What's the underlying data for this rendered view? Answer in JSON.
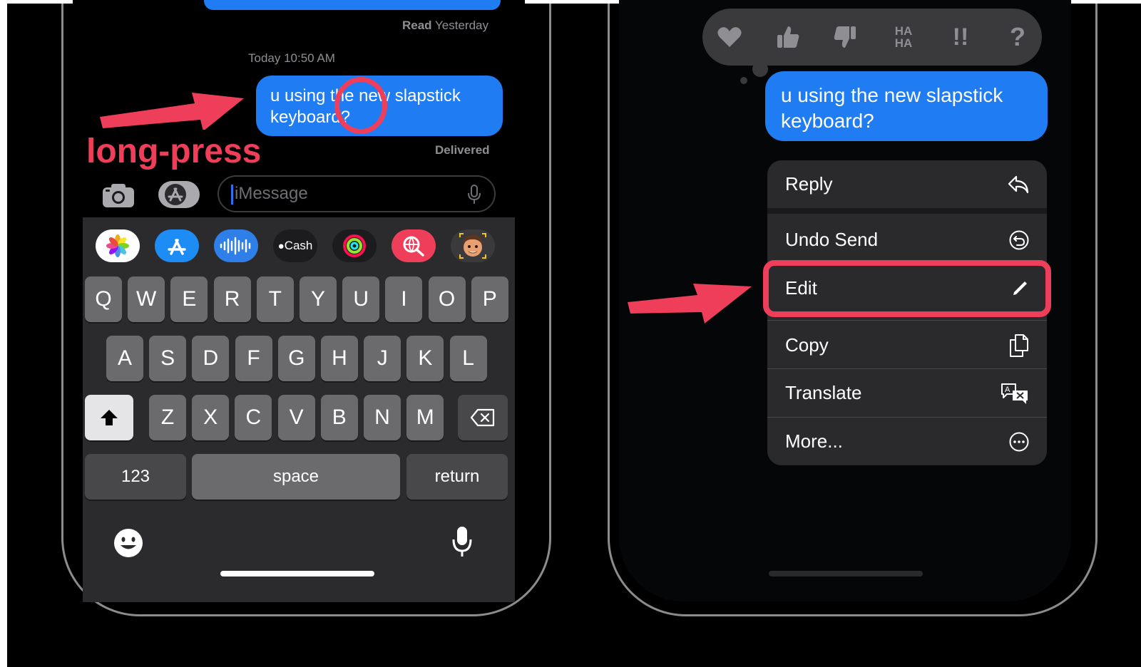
{
  "left_phone": {
    "read_status_bold": "Read",
    "read_status_rest": " Yesterday",
    "timestamp": "Today 10:50 AM",
    "message_line1": "u using the new slapstick",
    "message_line2": "keyboard?",
    "delivered": "Delivered",
    "annotation": "long-press",
    "input_placeholder": "iMessage",
    "app_strip": [
      "photos-icon",
      "app-store-icon",
      "audio-icon",
      "apple-cash-icon",
      "fitness-icon",
      "image-search-icon",
      "memoji-icon"
    ],
    "apple_cash_label": "Cash",
    "keys_row1": [
      "Q",
      "W",
      "E",
      "R",
      "T",
      "Y",
      "U",
      "I",
      "O",
      "P"
    ],
    "keys_row2": [
      "A",
      "S",
      "D",
      "F",
      "G",
      "H",
      "J",
      "K",
      "L"
    ],
    "keys_row3": [
      "Z",
      "X",
      "C",
      "V",
      "B",
      "N",
      "M"
    ],
    "key_numbers": "123",
    "key_space": "space",
    "key_return": "return"
  },
  "right_phone": {
    "reactions": [
      "heart-icon",
      "thumbs-up-icon",
      "thumbs-down-icon",
      "haha-icon",
      "exclamation-icon",
      "question-icon"
    ],
    "haha_label_1": "HA",
    "haha_label_2": "HA",
    "exclamation_label": "!!",
    "question_label": "?",
    "message_line1": "u using the new slapstick",
    "message_line2": "keyboard?",
    "menu": {
      "reply": "Reply",
      "undo_send": "Undo Send",
      "edit": "Edit",
      "copy": "Copy",
      "translate": "Translate",
      "more": "More..."
    }
  },
  "colors": {
    "bubble_blue": "#1f7cf2",
    "annotation_red": "#ef3e5a",
    "keyboard_bg": "#2b2b2d",
    "menu_bg": "#2a2a2c"
  }
}
